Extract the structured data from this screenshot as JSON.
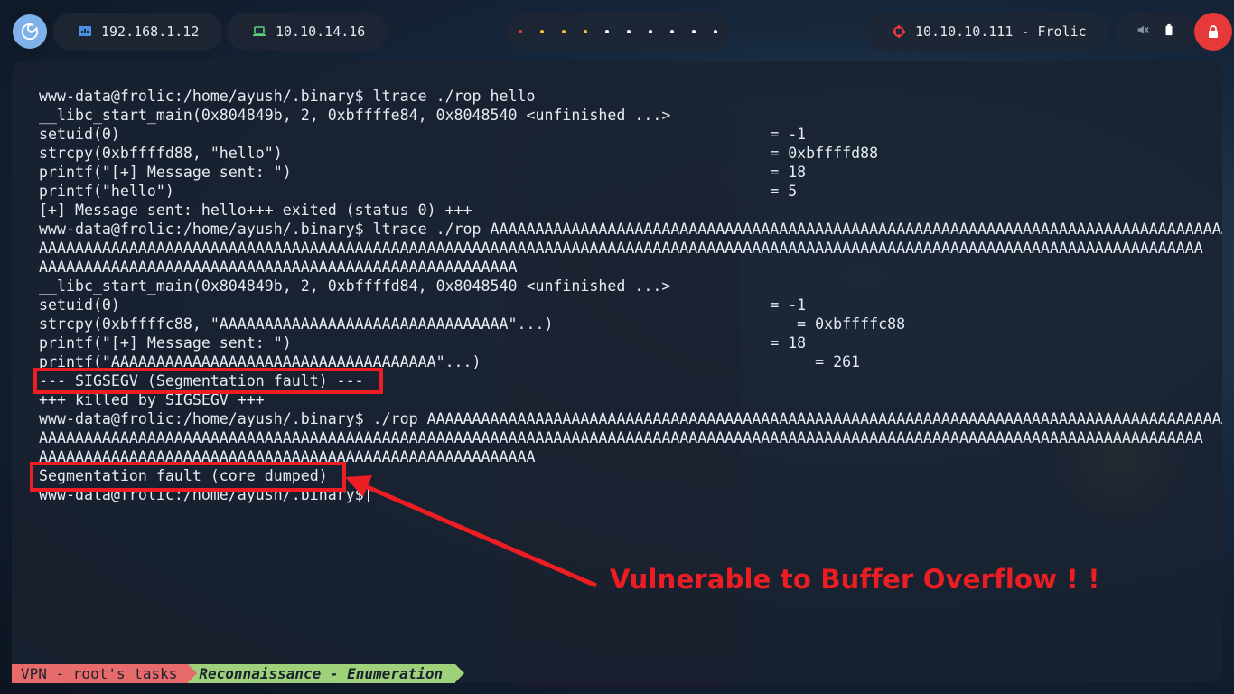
{
  "topbar": {
    "ip_local": "192.168.1.12",
    "ip_vpn": "10.10.14.16",
    "target": "10.10.10.111 - Frolic",
    "workspace_colors": [
      "#e5393a",
      "#f2c230",
      "#f2c230",
      "#f2c230",
      "#ffffff",
      "#ffffff",
      "#ffffff",
      "#ffffff",
      "#ffffff",
      "#ffffff"
    ]
  },
  "terminal": {
    "lines": [
      "www-data@frolic:/home/ayush/.binary$ ltrace ./rop hello",
      "__libc_start_main(0x804849b, 2, 0xbffffe84, 0x8048540 <unfinished ...>",
      "setuid(0)                                                                        = -1",
      "strcpy(0xbffffd88, \"hello\")                                                      = 0xbffffd88",
      "printf(\"[+] Message sent: \")                                                     = 18",
      "printf(\"hello\")                                                                  = 5",
      "[+] Message sent: hello+++ exited (status 0) +++",
      "www-data@frolic:/home/ayush/.binary$ ltrace ./rop AAAAAAAAAAAAAAAAAAAAAAAAAAAAAAAAAAAAAAAAAAAAAAAAAAAAAAAAAAAAAAAAAAAAAAAAAAAAAAAAAAAAAAAAA",
      "AAAAAAAAAAAAAAAAAAAAAAAAAAAAAAAAAAAAAAAAAAAAAAAAAAAAAAAAAAAAAAAAAAAAAAAAAAAAAAAAAAAAAAAAAAAAAAAAAAAAAAAAAAAAAAAAAAAAAAAAAAAAAAAAA",
      "AAAAAAAAAAAAAAAAAAAAAAAAAAAAAAAAAAAAAAAAAAAAAAAAAAAAA",
      "__libc_start_main(0x804849b, 2, 0xbffffd84, 0x8048540 <unfinished ...>",
      "setuid(0)                                                                        = -1",
      "strcpy(0xbffffc88, \"AAAAAAAAAAAAAAAAAAAAAAAAAAAAAAAA\"...)                           = 0xbffffc88",
      "printf(\"[+] Message sent: \")                                                     = 18",
      "printf(\"AAAAAAAAAAAAAAAAAAAAAAAAAAAAAAAAAAAA\"...)                                     = 261",
      "--- SIGSEGV (Segmentation fault) ---",
      "+++ killed by SIGSEGV +++",
      "www-data@frolic:/home/ayush/.binary$ ./rop AAAAAAAAAAAAAAAAAAAAAAAAAAAAAAAAAAAAAAAAAAAAAAAAAAAAAAAAAAAAAAAAAAAAAAAAAAAAAAAAAAAAAAAAAAAA",
      "AAAAAAAAAAAAAAAAAAAAAAAAAAAAAAAAAAAAAAAAAAAAAAAAAAAAAAAAAAAAAAAAAAAAAAAAAAAAAAAAAAAAAAAAAAAAAAAAAAAAAAAAAAAAAAAAAAAAAAAAAAAAAAAAA",
      "AAAAAAAAAAAAAAAAAAAAAAAAAAAAAAAAAAAAAAAAAAAAAAAAAAAAAAA",
      "Segmentation fault (core dumped)",
      "www-data@frolic:/home/ayush/.binary$"
    ]
  },
  "annotation": {
    "callout": "Vulnerable to Buffer Overflow ! !",
    "color": "#ec1e23"
  },
  "statusbar": {
    "left": "VPN - root's tasks",
    "right": "Reconnaissance - Enumeration"
  }
}
